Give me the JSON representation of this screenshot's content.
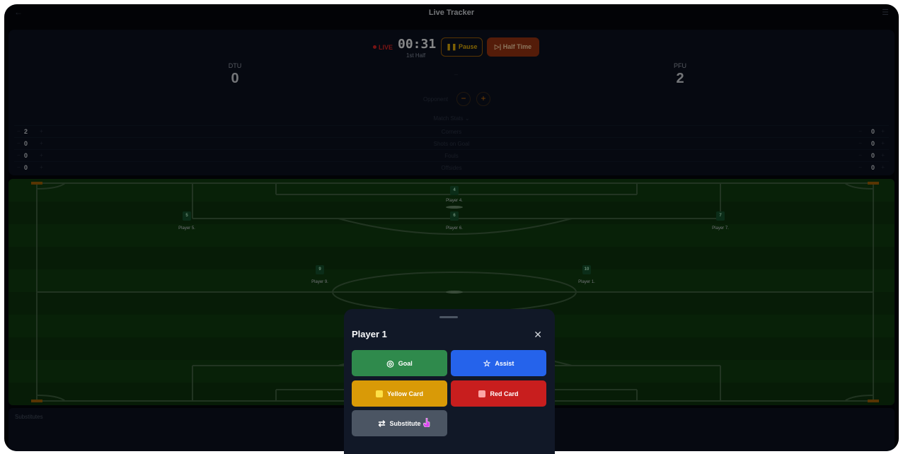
{
  "header": {
    "title": "Live Tracker",
    "back_icon": "arrow-left-icon",
    "menu_icon": "list-icon"
  },
  "match": {
    "live_label": "LIVE",
    "clock": "00:31",
    "period": "1st Half",
    "pause_label": "Pause",
    "half_time_label": "Half Time",
    "home": {
      "name": "DTU",
      "score": "0"
    },
    "away": {
      "name": "PFU",
      "score": "2"
    },
    "separator": "–",
    "opponent_label": "Opponent",
    "minus": "−",
    "plus": "+"
  },
  "stats": {
    "title": "Match Stats",
    "rows": [
      {
        "label": "Corners",
        "home": "2",
        "away": "0"
      },
      {
        "label": "Shots on Goal",
        "home": "0",
        "away": "0"
      },
      {
        "label": "Fouls",
        "home": "0",
        "away": "0"
      },
      {
        "label": "Offsides",
        "home": "0",
        "away": "0"
      }
    ]
  },
  "players": [
    {
      "number": "4",
      "name": "Player 4."
    },
    {
      "number": "5",
      "name": "Player 5."
    },
    {
      "number": "6",
      "name": "Player 6."
    },
    {
      "number": "7",
      "name": "Player 7."
    },
    {
      "number": "9",
      "name": "Player 9."
    },
    {
      "number": "10",
      "name": "Player 1."
    }
  ],
  "substitutes": {
    "title": "Substitutes"
  },
  "action_sheet": {
    "title": "Player 1",
    "goal_label": "Goal",
    "assist_label": "Assist",
    "yellow_label": "Yellow Card",
    "red_label": "Red Card",
    "substitute_label": "Substitute"
  },
  "colors": {
    "goal": "#2f8a4c",
    "assist": "#2563eb",
    "yellow_card": "#d99a07",
    "red_card": "#c81e1e",
    "substitute": "#4b5563",
    "half_time": "#9a3412",
    "pause_border": "#a16207",
    "live": "#dc2626"
  }
}
